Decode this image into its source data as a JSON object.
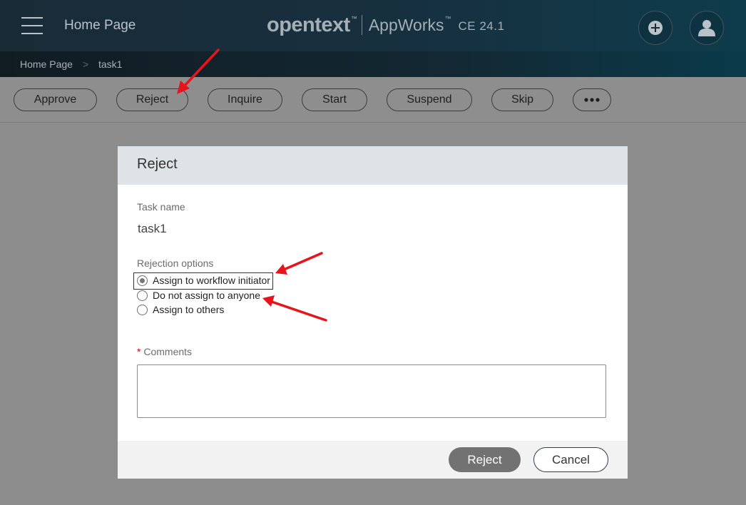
{
  "header": {
    "menu_icon": "hamburger-menu-icon",
    "title": "Home Page",
    "brand_logo": "opentext",
    "brand_tm": "™",
    "brand_product": "AppWorks",
    "brand_product_tm": "™",
    "brand_version": "CE  24.1",
    "add_icon": "plus-circle-icon",
    "user_icon": "user-avatar-icon"
  },
  "breadcrumb": {
    "items": [
      "Home Page",
      "task1"
    ],
    "separator": ">"
  },
  "toolbar": {
    "buttons": [
      "Approve",
      "Reject",
      "Inquire",
      "Start",
      "Suspend",
      "Skip"
    ],
    "more_icon": "more-horizontal-icon"
  },
  "dialog": {
    "title": "Reject",
    "task_name_label": "Task name",
    "task_name_value": "task1",
    "rejection_options_label": "Rejection options",
    "options": [
      {
        "label": "Assign to workflow initiator",
        "checked": true
      },
      {
        "label": "Do not assign to anyone",
        "checked": false
      },
      {
        "label": "Assign to others",
        "checked": false
      }
    ],
    "comments_required_mark": "*",
    "comments_label": "Comments",
    "comments_value": "",
    "primary_button": "Reject",
    "cancel_button": "Cancel"
  },
  "colors": {
    "annotation_arrow": "#e8141b",
    "header_bg": "#1a2b38",
    "overlay_bg": "#8c8c8c",
    "dialog_header_bg": "#dde3e6",
    "primary_button_bg": "#727272",
    "required_mark": "#d0021b"
  }
}
